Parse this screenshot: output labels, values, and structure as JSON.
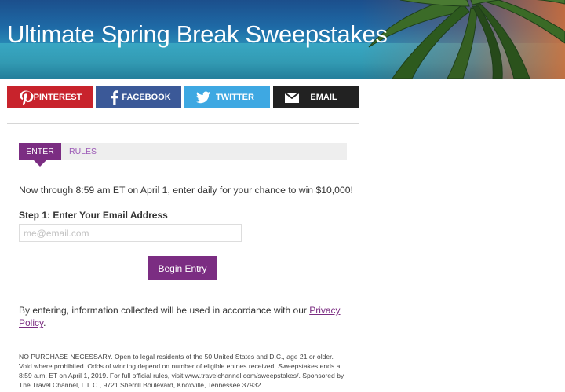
{
  "banner": {
    "title": "Ultimate Spring Break Sweepstakes"
  },
  "share": {
    "pinterest": {
      "label": "PINTEREST",
      "icon": "pinterest-icon",
      "color": "#c8232c"
    },
    "facebook": {
      "label": "FACEBOOK",
      "icon": "facebook-icon",
      "color": "#3b5998"
    },
    "twitter": {
      "label": "TWITTER",
      "icon": "twitter-icon",
      "color": "#3ea8e2"
    },
    "email": {
      "label": "EMAIL",
      "icon": "envelope-icon",
      "color": "#222222"
    }
  },
  "tabs": {
    "enter": "ENTER",
    "rules": "RULES",
    "active": "ENTER"
  },
  "form": {
    "intro": "Now through 8:59 am ET on April 1, enter daily for your chance to win $10,000!",
    "step_label": "Step 1: Enter Your Email Address",
    "email_placeholder": "me@email.com",
    "email_value": "",
    "submit_label": "Begin Entry"
  },
  "privacy": {
    "text": "By entering, information collected will be used in accordance with our ",
    "link_text": "Privacy Policy",
    "suffix": "."
  },
  "legal": {
    "text": "NO PURCHASE NECESSARY. Open to legal residents of the 50 United States and D.C., age 21 or older. Void where prohibited. Odds of winning depend on number of eligible entries received.  Sweepstakes ends at 8:59 a.m. ET on April 1, 2019. For full official rules, visit www.travelchannel.com/sweepstakes/. Sponsored by The Travel Channel, L.L.C., 9721 Sherrill Boulevard, Knoxville, Tennessee 37932."
  },
  "colors": {
    "accent": "#7b2d82",
    "tab_bar": "#eeeeee"
  }
}
